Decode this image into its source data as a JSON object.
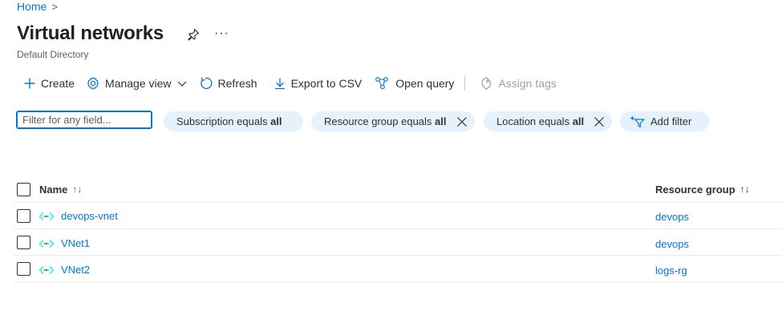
{
  "breadcrumb": {
    "home": "Home",
    "separator": ">"
  },
  "header": {
    "title": "Virtual networks",
    "subtitle": "Default Directory",
    "more": "···"
  },
  "toolbar": {
    "create": "Create",
    "manage_view": "Manage view",
    "refresh": "Refresh",
    "export_csv": "Export to CSV",
    "open_query": "Open query",
    "assign_tags": "Assign tags"
  },
  "filters": {
    "search_placeholder": "Filter for any field...",
    "pills": [
      {
        "label": "Subscription equals ",
        "value": "all"
      },
      {
        "label": "Resource group equals ",
        "value": "all"
      },
      {
        "label": "Location equals ",
        "value": "all"
      }
    ],
    "add_filter": "Add filter"
  },
  "table": {
    "columns": {
      "name": "Name",
      "resource_group": "Resource group",
      "sort_glyph": "↑↓"
    },
    "rows": [
      {
        "name": "devops-vnet",
        "resource_group": "devops"
      },
      {
        "name": "VNet1",
        "resource_group": "devops"
      },
      {
        "name": "VNet2",
        "resource_group": "logs-rg"
      }
    ]
  },
  "colors": {
    "accent": "#0078d4",
    "pill_bg": "#e5f1fb",
    "vnet_icon": "#50e6ff"
  }
}
